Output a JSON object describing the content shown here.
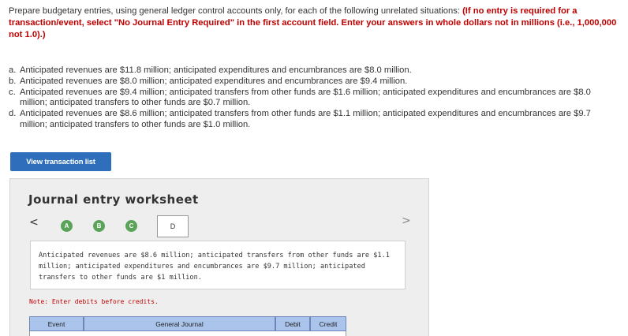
{
  "intro": {
    "text": "Prepare budgetary entries, using general ledger control accounts only, for each of the following unrelated situations: ",
    "instruction": "(If no entry is required for a transaction/event, select \"No Journal Entry Required\" in the first account field. Enter your answers in whole dollars not in millions (i.e., 1,000,000 not 1.0).)"
  },
  "items": [
    {
      "letter": "a.",
      "text": "Anticipated revenues are $11.8 million; anticipated expenditures and encumbrances are $8.0 million."
    },
    {
      "letter": "b.",
      "text": "Anticipated revenues are $8.0 million; anticipated expenditures and encumbrances are $9.4 million."
    },
    {
      "letter": "c.",
      "text": "Anticipated revenues are $9.4 million; anticipated transfers from other funds are $1.6 million; anticipated expenditures and encumbrances are $8.0 million; anticipated transfers to other funds are $0.7 million."
    },
    {
      "letter": "d.",
      "text": "Anticipated revenues are $8.6 million; anticipated transfers from other funds are $1.1 million; anticipated expenditures and encumbrances are $9.7 million; anticipated transfers to other funds are $1.0 million."
    }
  ],
  "view_button": "View transaction list",
  "worksheet": {
    "title": "Journal entry worksheet",
    "prev": "<",
    "next": ">",
    "steps": [
      "A",
      "B",
      "C",
      "D"
    ],
    "description": "Anticipated revenues are $8.6 million; anticipated transfers from other funds are $1.1 million; anticipated expenditures and encumbrances are $9.7 million; anticipated transfers to other funds are $1 million.",
    "note": "Note: Enter debits before credits.",
    "columns": {
      "event": "Event",
      "general_journal": "General Journal",
      "debit": "Debit",
      "credit": "Credit"
    }
  },
  "colors": {
    "accent": "#2f6eba",
    "required": "#c00000",
    "step_done": "#5aa45a",
    "table_header": "#aac4ec"
  }
}
